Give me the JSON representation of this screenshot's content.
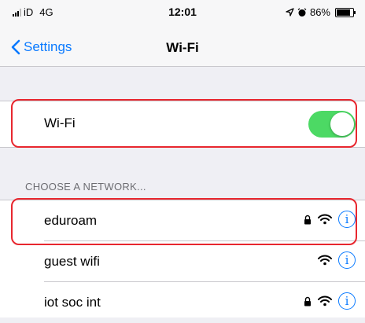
{
  "status_bar": {
    "carrier": "iD",
    "network": "4G",
    "time": "12:01",
    "battery_percent_label": "86%",
    "battery_fraction": 0.86
  },
  "nav": {
    "back_label": "Settings",
    "title": "Wi-Fi"
  },
  "wifi_toggle": {
    "label": "Wi-Fi",
    "on": true
  },
  "section": {
    "header": "CHOOSE A NETWORK..."
  },
  "networks": [
    {
      "name": "eduroam",
      "secured": true
    },
    {
      "name": "guest wifi",
      "secured": false
    },
    {
      "name": "iot soc int",
      "secured": true
    }
  ],
  "icons": {
    "info": "i"
  },
  "colors": {
    "accent": "#0a7aff",
    "toggle_on": "#4cd964",
    "highlight": "#e8272f"
  }
}
